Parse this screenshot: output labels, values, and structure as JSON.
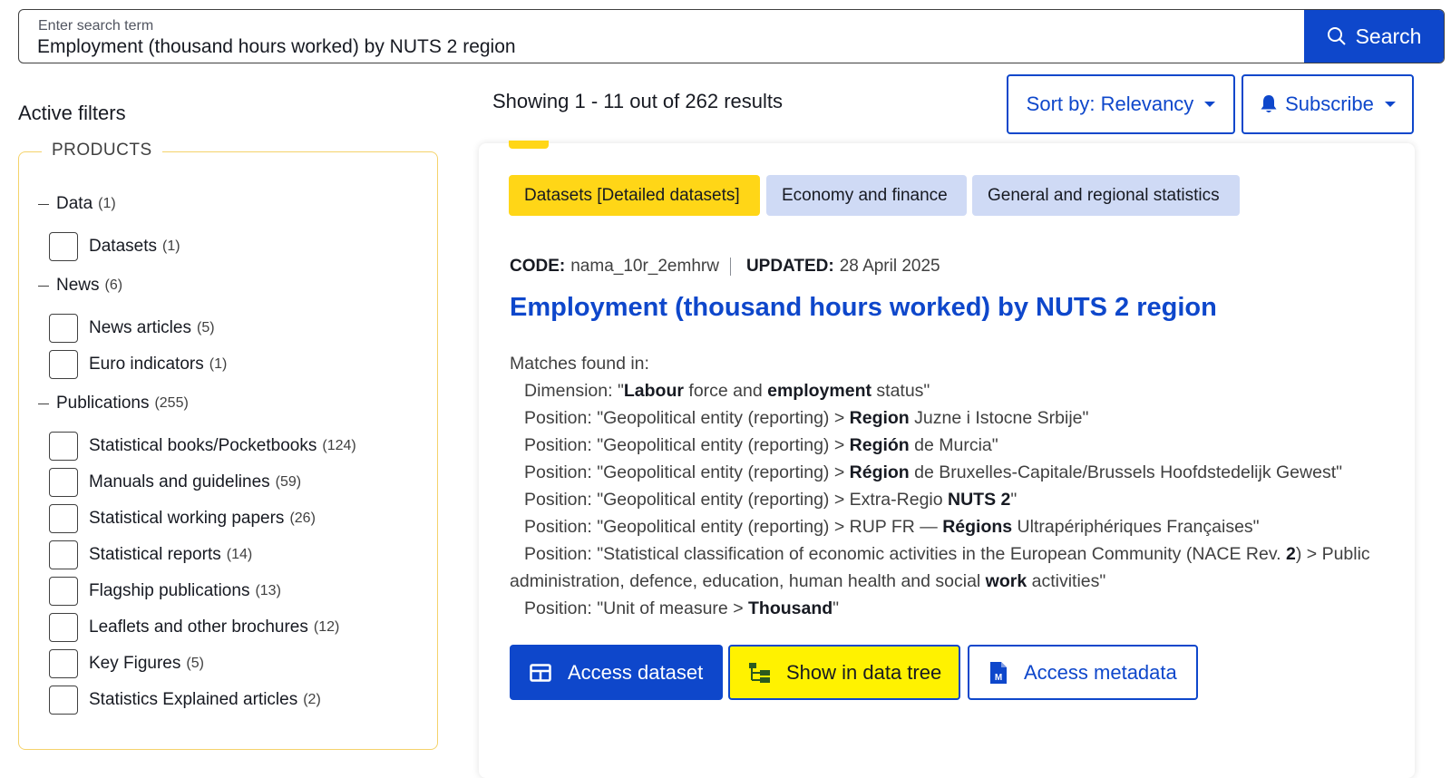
{
  "search": {
    "label": "Enter search term",
    "value": "Employment (thousand hours worked) by NUTS 2 region",
    "button_label": "Search"
  },
  "sidebar": {
    "active_filters": "Active filters",
    "products_title": "PRODUCTS",
    "groups": [
      {
        "label": "Data",
        "count": "(1)",
        "items": [
          {
            "label": "Datasets",
            "count": "(1)"
          }
        ]
      },
      {
        "label": "News",
        "count": "(6)",
        "items": [
          {
            "label": "News articles",
            "count": "(5)"
          },
          {
            "label": "Euro indicators",
            "count": "(1)"
          }
        ]
      },
      {
        "label": "Publications",
        "count": "(255)",
        "items": [
          {
            "label": "Statistical books/Pocketbooks",
            "count": "(124)"
          },
          {
            "label": "Manuals and guidelines",
            "count": "(59)"
          },
          {
            "label": "Statistical working papers",
            "count": "(26)"
          },
          {
            "label": "Statistical reports",
            "count": "(14)"
          },
          {
            "label": "Flagship publications",
            "count": "(13)"
          },
          {
            "label": "Leaflets and other brochures",
            "count": "(12)"
          },
          {
            "label": "Key Figures",
            "count": "(5)"
          },
          {
            "label": "Statistics Explained articles",
            "count": "(2)"
          }
        ]
      }
    ]
  },
  "results": {
    "showing": "Showing 1 - 11 out of 262 results",
    "sort_label": "Sort by: Relevancy",
    "subscribe_label": "Subscribe"
  },
  "card": {
    "tags": [
      "Datasets [Detailed datasets]",
      "Economy and finance",
      "General and regional statistics"
    ],
    "code_label": "CODE:",
    "code_value": "nama_10r_2emhrw",
    "updated_label": "UPDATED:",
    "updated_value": "28 April 2025",
    "title": "Employment (thousand hours worked) by NUTS 2 region",
    "matches_heading": "Matches found in:",
    "matches": [
      [
        "Dimension: \"",
        "*Labour",
        " force and ",
        "*employment",
        " status\""
      ],
      [
        "Position: \"Geopolitical entity (reporting) > ",
        "*Region",
        " Juzne i Istocne Srbije\""
      ],
      [
        "Position: \"Geopolitical entity (reporting) > ",
        "*Región",
        " de Murcia\""
      ],
      [
        "Position: \"Geopolitical entity (reporting) > ",
        "*Région",
        " de Bruxelles-Capitale/Brussels Hoofdstedelijk Gewest\""
      ],
      [
        "Position: \"Geopolitical entity (reporting) > Extra-Regio ",
        "*NUTS 2",
        "\""
      ],
      [
        "Position: \"Geopolitical entity (reporting) > RUP FR — ",
        "*Régions",
        " Ultrapériphériques Françaises\""
      ],
      [
        "Position: \"Statistical classification of economic activities in the European Community (NACE Rev. ",
        "*2",
        ") > Public administration, defence, education, human health and social ",
        "*work",
        " activities\""
      ],
      [
        "Position: \"Unit of measure > ",
        "*Thousand",
        "\""
      ]
    ],
    "buttons": {
      "access_dataset": "Access dataset",
      "show_tree": "Show in data tree",
      "access_metadata": "Access metadata"
    }
  },
  "colors": {
    "primary": "#0e47cb",
    "tag_yellow": "#ffd617",
    "tag_blue": "#cfdaf5",
    "highlight": "#fff200",
    "filter_border": "#f5d36b"
  }
}
